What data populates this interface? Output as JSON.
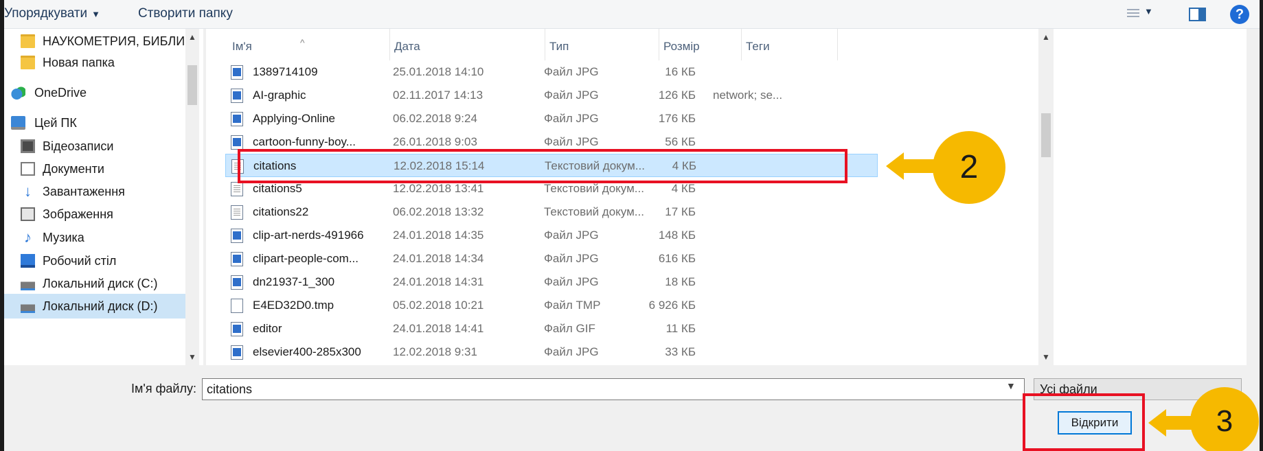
{
  "toolbar": {
    "organize_label": "Упорядкувати",
    "new_folder_label": "Створити папку",
    "help_label": "?"
  },
  "nav": {
    "items": [
      {
        "label": "НАУКОМЕТРИЯ, БИБЛИ",
        "icon": "folder-icon"
      },
      {
        "label": "Новая папка",
        "icon": "folder-icon"
      },
      {
        "label": "OneDrive",
        "icon": "onedrive-icon"
      },
      {
        "label": "Цей ПК",
        "icon": "computer-icon"
      },
      {
        "label": "Відеозаписи",
        "icon": "videos-icon"
      },
      {
        "label": "Документи",
        "icon": "documents-icon"
      },
      {
        "label": "Завантаження",
        "icon": "downloads-icon"
      },
      {
        "label": "Зображення",
        "icon": "pictures-icon"
      },
      {
        "label": "Музика",
        "icon": "music-icon"
      },
      {
        "label": "Робочий стіл",
        "icon": "desktop-icon"
      },
      {
        "label": "Локальний диск (C:)",
        "icon": "drive-icon"
      },
      {
        "label": "Локальний диск (D:)",
        "icon": "drive-icon"
      }
    ]
  },
  "list": {
    "columns": {
      "name": "Ім'я",
      "date": "Дата",
      "type": "Тип",
      "size": "Розмір",
      "tags": "Теги"
    },
    "files": [
      {
        "name": "1389714109",
        "date": "25.01.2018 14:10",
        "type": "Файл JPG",
        "size": "16 КБ",
        "tags": "",
        "icon": "jpg"
      },
      {
        "name": "AI-graphic",
        "date": "02.11.2017 14:13",
        "type": "Файл JPG",
        "size": "126 КБ",
        "tags": "network; se...",
        "icon": "jpg"
      },
      {
        "name": "Applying-Online",
        "date": "06.02.2018 9:24",
        "type": "Файл JPG",
        "size": "176 КБ",
        "tags": "",
        "icon": "jpg"
      },
      {
        "name": "cartoon-funny-boy...",
        "date": "26.01.2018 9:03",
        "type": "Файл JPG",
        "size": "56 КБ",
        "tags": "",
        "icon": "jpg"
      },
      {
        "name": "citations",
        "date": "12.02.2018 15:14",
        "type": "Текстовий докум...",
        "size": "4 КБ",
        "tags": "",
        "icon": "txt"
      },
      {
        "name": "citations5",
        "date": "12.02.2018 13:41",
        "type": "Текстовий докум...",
        "size": "4 КБ",
        "tags": "",
        "icon": "txt"
      },
      {
        "name": "citations22",
        "date": "06.02.2018 13:32",
        "type": "Текстовий докум...",
        "size": "17 КБ",
        "tags": "",
        "icon": "txt"
      },
      {
        "name": "clip-art-nerds-491966",
        "date": "24.01.2018 14:35",
        "type": "Файл JPG",
        "size": "148 КБ",
        "tags": "",
        "icon": "jpg"
      },
      {
        "name": "clipart-people-com...",
        "date": "24.01.2018 14:34",
        "type": "Файл JPG",
        "size": "616 КБ",
        "tags": "",
        "icon": "jpg"
      },
      {
        "name": "dn21937-1_300",
        "date": "24.01.2018 14:31",
        "type": "Файл JPG",
        "size": "18 КБ",
        "tags": "",
        "icon": "jpg"
      },
      {
        "name": "E4ED32D0.tmp",
        "date": "05.02.2018 10:21",
        "type": "Файл TMP",
        "size": "6 926 КБ",
        "tags": "",
        "icon": "tmp"
      },
      {
        "name": "editor",
        "date": "24.01.2018 14:41",
        "type": "Файл GIF",
        "size": "11 КБ",
        "tags": "",
        "icon": "jpg"
      },
      {
        "name": "elsevier400-285x300",
        "date": "12.02.2018 9:31",
        "type": "Файл JPG",
        "size": "33 КБ",
        "tags": "",
        "icon": "jpg"
      }
    ]
  },
  "filename": {
    "label": "Ім'я файлу:",
    "value": "citations"
  },
  "file_type_filter": "Усі файли",
  "open_button_label": "Відкрити",
  "callouts": {
    "step2": "2",
    "step3": "3"
  },
  "colors": {
    "highlight": "#e81123",
    "callout": "#f6b900",
    "selection": "#cce8ff"
  }
}
